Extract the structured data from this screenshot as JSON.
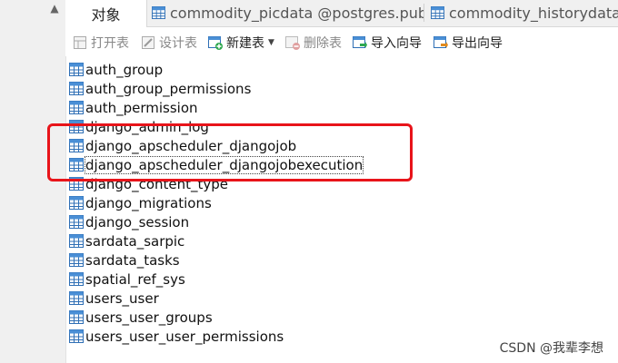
{
  "tabs": [
    {
      "label": "对象",
      "active": true
    },
    {
      "label": "commodity_picdata @postgres.publ...",
      "active": false
    },
    {
      "label": "commodity_historydata @",
      "active": false
    }
  ],
  "toolbar": {
    "open_table": "打开表",
    "design_table": "设计表",
    "new_table": "新建表",
    "delete_table": "删除表",
    "import_wizard": "导入向导",
    "export_wizard": "导出向导"
  },
  "tables": [
    "auth_group",
    "auth_group_permissions",
    "auth_permission",
    "django_admin_log",
    "django_apscheduler_djangojob",
    "django_apscheduler_djangojobexecution",
    "django_content_type",
    "django_migrations",
    "django_session",
    "sardata_sarpic",
    "sardata_tasks",
    "spatial_ref_sys",
    "users_user",
    "users_user_groups",
    "users_user_user_permissions"
  ],
  "selected_table": "django_apscheduler_djangojobexecution",
  "watermark": "CSDN @我辈李想",
  "colors": {
    "highlight_box": "#e8141a",
    "table_icon": "#2f6fb5"
  }
}
